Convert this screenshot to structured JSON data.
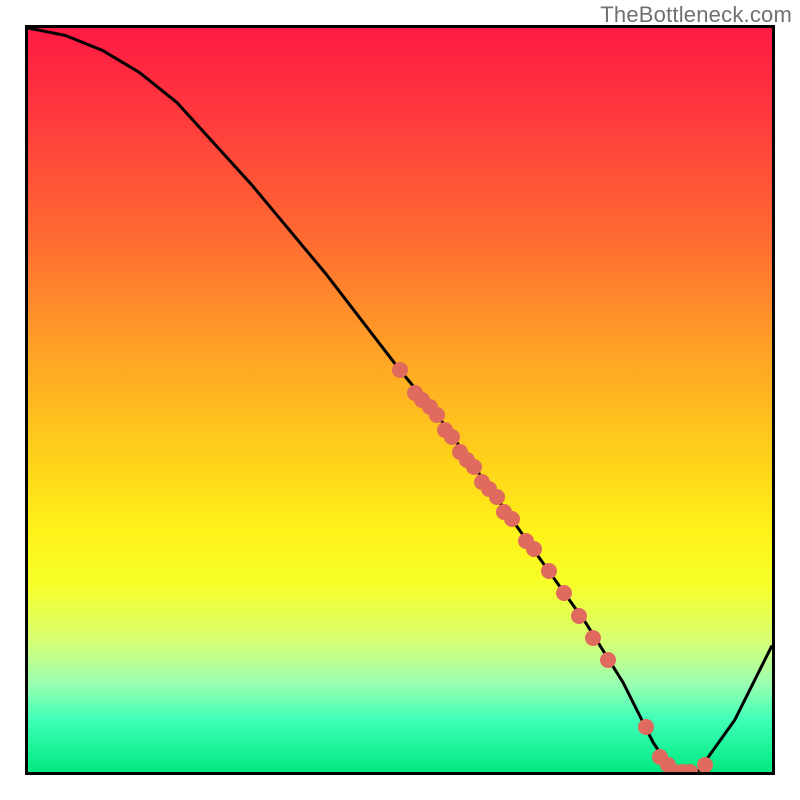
{
  "watermark": "TheBottleneck.com",
  "chart_data": {
    "type": "line",
    "title": "",
    "xlabel": "",
    "ylabel": "",
    "x_range": [
      0,
      100
    ],
    "y_range": [
      0,
      100
    ],
    "series": [
      {
        "name": "curve",
        "x": [
          0,
          5,
          10,
          15,
          20,
          30,
          40,
          50,
          55,
          60,
          65,
          70,
          75,
          80,
          82,
          84,
          86,
          88,
          90,
          95,
          100
        ],
        "y": [
          100,
          99,
          97,
          94,
          90,
          79,
          67,
          54,
          48,
          41,
          34,
          27,
          20,
          12,
          8,
          4,
          1,
          0,
          0,
          7,
          17
        ]
      }
    ],
    "markers": [
      {
        "x": 50,
        "y": 54
      },
      {
        "x": 52,
        "y": 51
      },
      {
        "x": 53,
        "y": 50
      },
      {
        "x": 54,
        "y": 49
      },
      {
        "x": 55,
        "y": 48
      },
      {
        "x": 56,
        "y": 46
      },
      {
        "x": 57,
        "y": 45
      },
      {
        "x": 58,
        "y": 43
      },
      {
        "x": 59,
        "y": 42
      },
      {
        "x": 60,
        "y": 41
      },
      {
        "x": 61,
        "y": 39
      },
      {
        "x": 62,
        "y": 38
      },
      {
        "x": 63,
        "y": 37
      },
      {
        "x": 64,
        "y": 35
      },
      {
        "x": 65,
        "y": 34
      },
      {
        "x": 67,
        "y": 31
      },
      {
        "x": 68,
        "y": 30
      },
      {
        "x": 70,
        "y": 27
      },
      {
        "x": 72,
        "y": 24
      },
      {
        "x": 74,
        "y": 21
      },
      {
        "x": 76,
        "y": 18
      },
      {
        "x": 78,
        "y": 15
      },
      {
        "x": 83,
        "y": 6
      },
      {
        "x": 85,
        "y": 2
      },
      {
        "x": 86,
        "y": 1
      },
      {
        "x": 87,
        "y": 0
      },
      {
        "x": 88,
        "y": 0
      },
      {
        "x": 89,
        "y": 0
      },
      {
        "x": 91,
        "y": 1
      }
    ],
    "gradient_stops": [
      {
        "pos": 0,
        "color": "#ff1a44"
      },
      {
        "pos": 12,
        "color": "#ff3a3d"
      },
      {
        "pos": 28,
        "color": "#ff6a32"
      },
      {
        "pos": 45,
        "color": "#ffa724"
      },
      {
        "pos": 58,
        "color": "#ffd21a"
      },
      {
        "pos": 68,
        "color": "#fff31a"
      },
      {
        "pos": 75,
        "color": "#f6ff2a"
      },
      {
        "pos": 82,
        "color": "#d9ff70"
      },
      {
        "pos": 88,
        "color": "#9dffb0"
      },
      {
        "pos": 93,
        "color": "#3fffb8"
      },
      {
        "pos": 100,
        "color": "#00e97f"
      }
    ]
  }
}
